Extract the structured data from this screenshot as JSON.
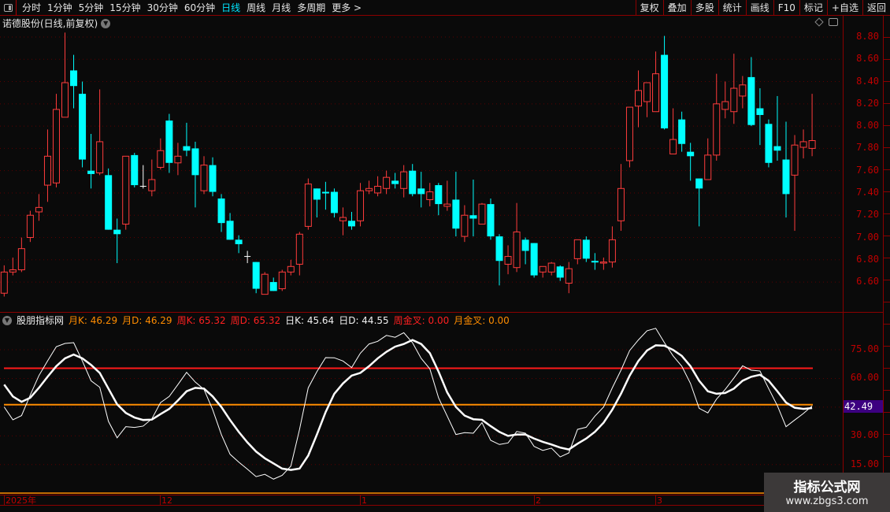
{
  "toolbar": {
    "periods": [
      "分时",
      "1分钟",
      "5分钟",
      "15分钟",
      "30分钟",
      "60分钟",
      "日线",
      "周线",
      "月线",
      "多周期",
      "更多 >"
    ],
    "active": "日线",
    "buttons": [
      "复权",
      "叠加",
      "多股",
      "统计",
      "画线",
      "F10",
      "标记",
      "+自选",
      "返回"
    ]
  },
  "stock_title": "诺德股份(日线,前复权)",
  "price_axis": [
    "8.80",
    "8.60",
    "8.40",
    "8.20",
    "8.00",
    "7.80",
    "7.60",
    "7.40",
    "7.20",
    "7.00",
    "6.80",
    "6.60"
  ],
  "indicator": {
    "name": "股朋指标网",
    "items": [
      {
        "label": "月K: 46.29",
        "color": "o"
      },
      {
        "label": "月D: 46.29",
        "color": "o"
      },
      {
        "label": "周K: 65.32",
        "color": "r"
      },
      {
        "label": "周D: 65.32",
        "color": "r"
      },
      {
        "label": "日K: 45.64",
        "color": "w"
      },
      {
        "label": "日D: 44.55",
        "color": "w"
      },
      {
        "label": "周金叉: 0.00",
        "color": "r"
      },
      {
        "label": "月金叉: 0.00",
        "color": "o"
      }
    ],
    "axis": [
      "75.00",
      "60.00",
      "30.00",
      "15.00"
    ],
    "current_value": "42.49"
  },
  "dates": [
    "2025年",
    "12",
    "1",
    "2",
    "3"
  ],
  "watermark": {
    "line1": "指标公式网",
    "line2": "www.zbgs3.com"
  },
  "colors": {
    "up": "#ff3c3c",
    "down": "#00ffff",
    "monthly": "#ff8c00",
    "weekly": "#ff1a1a"
  },
  "chart_data": {
    "type": "candlestick",
    "ohlc_order": "open,high,low,close",
    "candles": [
      [
        6.5,
        6.75,
        6.47,
        6.69
      ],
      [
        6.69,
        6.82,
        6.66,
        6.71
      ],
      [
        6.71,
        7.0,
        6.69,
        6.9
      ],
      [
        7.0,
        7.24,
        6.96,
        7.2
      ],
      [
        7.23,
        7.39,
        7.15,
        7.27
      ],
      [
        7.47,
        7.97,
        7.32,
        7.73
      ],
      [
        7.49,
        8.29,
        7.45,
        8.15
      ],
      [
        8.08,
        8.84,
        8.08,
        8.39
      ],
      [
        8.5,
        8.64,
        8.16,
        8.36
      ],
      [
        8.29,
        8.4,
        7.63,
        7.7
      ],
      [
        7.6,
        7.93,
        7.44,
        7.57
      ],
      [
        7.58,
        8.33,
        7.56,
        7.86
      ],
      [
        7.56,
        7.62,
        7.07,
        7.07
      ],
      [
        7.07,
        7.17,
        6.77,
        7.03
      ],
      [
        7.12,
        7.73,
        7.07,
        7.73
      ],
      [
        7.74,
        7.76,
        7.45,
        7.47
      ],
      [
        7.46,
        7.65,
        7.44,
        7.46
      ],
      [
        7.42,
        7.7,
        7.37,
        7.52
      ],
      [
        7.63,
        7.89,
        7.61,
        7.78
      ],
      [
        8.05,
        8.11,
        7.58,
        7.67
      ],
      [
        7.67,
        7.85,
        7.56,
        7.73
      ],
      [
        7.82,
        8.03,
        7.73,
        7.78
      ],
      [
        7.8,
        7.86,
        7.27,
        7.56
      ],
      [
        7.42,
        7.73,
        7.39,
        7.65
      ],
      [
        7.65,
        7.72,
        7.37,
        7.41
      ],
      [
        7.35,
        7.39,
        7.05,
        7.13
      ],
      [
        7.15,
        7.22,
        6.98,
        6.98
      ],
      [
        6.98,
        7.02,
        6.86,
        6.94
      ],
      [
        6.83,
        6.88,
        6.77,
        6.83
      ],
      [
        6.78,
        6.78,
        6.5,
        6.54
      ],
      [
        6.49,
        6.69,
        6.49,
        6.67
      ],
      [
        6.6,
        6.64,
        6.52,
        6.52
      ],
      [
        6.54,
        6.71,
        6.52,
        6.69
      ],
      [
        6.69,
        6.8,
        6.66,
        6.74
      ],
      [
        6.76,
        7.05,
        6.66,
        7.03
      ],
      [
        7.1,
        7.53,
        7.07,
        7.48
      ],
      [
        7.44,
        7.44,
        7.18,
        7.34
      ],
      [
        7.41,
        7.5,
        7.25,
        7.4
      ],
      [
        7.41,
        7.44,
        7.18,
        7.22
      ],
      [
        7.15,
        7.27,
        7.02,
        7.18
      ],
      [
        7.15,
        7.23,
        7.07,
        7.1
      ],
      [
        7.15,
        7.49,
        7.1,
        7.42
      ],
      [
        7.42,
        7.51,
        7.39,
        7.44
      ],
      [
        7.4,
        7.55,
        7.37,
        7.46
      ],
      [
        7.44,
        7.6,
        7.39,
        7.54
      ],
      [
        7.51,
        7.58,
        7.44,
        7.48
      ],
      [
        7.44,
        7.65,
        7.36,
        7.59
      ],
      [
        7.6,
        7.66,
        7.37,
        7.39
      ],
      [
        7.44,
        7.59,
        7.27,
        7.39
      ],
      [
        7.34,
        7.49,
        7.28,
        7.41
      ],
      [
        7.47,
        7.49,
        7.2,
        7.3
      ],
      [
        7.28,
        7.51,
        7.24,
        7.3
      ],
      [
        7.34,
        7.59,
        7.01,
        7.08
      ],
      [
        7.01,
        7.29,
        6.96,
        7.2
      ],
      [
        7.2,
        7.52,
        7.01,
        7.17
      ],
      [
        7.12,
        7.31,
        7.12,
        7.3
      ],
      [
        7.3,
        7.35,
        6.98,
        7.01
      ],
      [
        7.01,
        7.03,
        6.57,
        6.79
      ],
      [
        6.76,
        6.93,
        6.67,
        6.83
      ],
      [
        6.73,
        7.31,
        6.69,
        7.05
      ],
      [
        6.98,
        7.0,
        6.76,
        6.88
      ],
      [
        6.95,
        6.95,
        6.64,
        6.66
      ],
      [
        6.69,
        6.74,
        6.64,
        6.74
      ],
      [
        6.69,
        6.78,
        6.66,
        6.77
      ],
      [
        6.74,
        6.75,
        6.61,
        6.64
      ],
      [
        6.59,
        6.78,
        6.5,
        6.72
      ],
      [
        6.81,
        6.98,
        6.76,
        6.98
      ],
      [
        6.98,
        7.01,
        6.78,
        6.81
      ],
      [
        6.79,
        6.86,
        6.71,
        6.78
      ],
      [
        6.77,
        6.82,
        6.71,
        6.78
      ],
      [
        6.78,
        7.1,
        6.73,
        6.98
      ],
      [
        7.15,
        7.66,
        7.06,
        7.44
      ],
      [
        7.69,
        8.17,
        7.63,
        8.17
      ],
      [
        8.18,
        8.5,
        7.99,
        8.32
      ],
      [
        8.22,
        8.39,
        8.08,
        8.39
      ],
      [
        8.13,
        8.67,
        8.13,
        8.47
      ],
      [
        8.64,
        8.81,
        7.97,
        7.98
      ],
      [
        7.75,
        8.16,
        7.75,
        7.88
      ],
      [
        8.06,
        8.13,
        7.77,
        7.84
      ],
      [
        7.77,
        7.85,
        7.51,
        7.73
      ],
      [
        7.53,
        7.53,
        7.1,
        7.44
      ],
      [
        7.52,
        7.89,
        7.52,
        7.74
      ],
      [
        7.74,
        8.47,
        7.69,
        8.2
      ],
      [
        8.15,
        8.4,
        8.07,
        8.22
      ],
      [
        8.13,
        8.65,
        8.02,
        8.34
      ],
      [
        8.27,
        8.45,
        8.16,
        8.37
      ],
      [
        8.44,
        8.62,
        8.0,
        8.01
      ],
      [
        8.16,
        8.34,
        7.83,
        8.1
      ],
      [
        8.02,
        8.06,
        7.63,
        7.67
      ],
      [
        7.82,
        8.27,
        7.69,
        7.78
      ],
      [
        7.7,
        8.04,
        7.18,
        7.39
      ],
      [
        7.56,
        7.92,
        7.06,
        7.83
      ],
      [
        7.81,
        7.97,
        7.71,
        7.86
      ],
      [
        7.8,
        8.29,
        7.73,
        7.87
      ]
    ],
    "indicator": {
      "monthly_kd": 46.29,
      "weekly_kd": 65.32,
      "daily_K": [
        45.1,
        38.4,
        40.6,
        51.3,
        61.5,
        69.2,
        76.6,
        78.3,
        78.7,
        69.1,
        58.8,
        55.4,
        37.6,
        29.0,
        34.8,
        34.4,
        35.1,
        38.9,
        47.4,
        50.6,
        56.8,
        63.2,
        58.1,
        54.3,
        43.7,
        30.7,
        20.4,
        16.3,
        12.6,
        8.7,
        9.9,
        7.4,
        9.4,
        14.2,
        33.4,
        55.1,
        63.6,
        70.9,
        70.8,
        69.1,
        65.7,
        73.2,
        78.0,
        79.4,
        82.5,
        81.5,
        83.9,
        78.7,
        70.5,
        65.0,
        49.9,
        40.3,
        30.7,
        31.7,
        31.4,
        36.9,
        27.7,
        25.5,
        26.3,
        32.3,
        31.4,
        24.5,
        22.4,
        23.6,
        19.0,
        21.1,
        33.4,
        34.5,
        40.3,
        45.1,
        55.1,
        64.3,
        74.6,
        80.1,
        84.9,
        86.2,
        78.7,
        71.8,
        66.4,
        57.4,
        44.4,
        42.0,
        49.2,
        54.3,
        60.2,
        66.6,
        64.3,
        63.9,
        54.7,
        45.8,
        34.8,
        38.3,
        41.7,
        45.64
      ],
      "daily_D": [
        56.8,
        50.6,
        47.8,
        49.9,
        55.1,
        60.9,
        66.4,
        70.5,
        72.5,
        70.5,
        67.1,
        62.9,
        54.7,
        46.5,
        42.0,
        39.6,
        38.3,
        38.5,
        41.4,
        44.1,
        48.5,
        53.3,
        55.1,
        54.7,
        50.6,
        45.1,
        38.3,
        32.1,
        26.6,
        21.8,
        18.3,
        15.6,
        12.9,
        12.2,
        12.9,
        19.7,
        30.7,
        42.4,
        52.0,
        57.4,
        61.5,
        62.9,
        66.4,
        70.5,
        73.9,
        76.6,
        78.0,
        80.1,
        78.0,
        73.2,
        63.6,
        52.7,
        45.1,
        40.6,
        38.7,
        38.4,
        35.1,
        32.1,
        30.0,
        30.7,
        30.7,
        28.6,
        26.9,
        25.5,
        23.9,
        22.9,
        25.9,
        28.6,
        32.1,
        36.9,
        43.7,
        52.0,
        61.5,
        69.1,
        74.6,
        77.3,
        77.1,
        74.9,
        71.8,
        66.4,
        58.8,
        53.3,
        52.0,
        52.4,
        54.7,
        58.8,
        60.9,
        61.9,
        58.8,
        53.3,
        47.4,
        44.7,
        44.1,
        44.55
      ]
    },
    "price_range": [
      6.5,
      8.84
    ],
    "indicator_range": [
      0,
      100
    ]
  }
}
